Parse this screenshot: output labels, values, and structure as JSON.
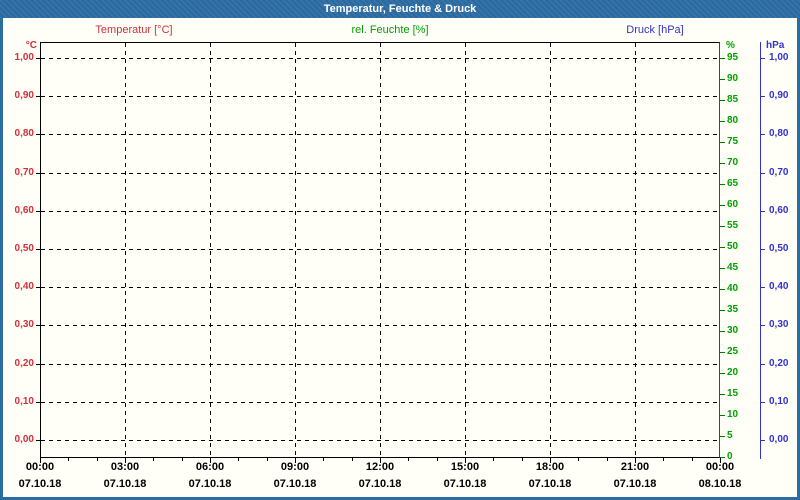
{
  "header": {
    "title": "Temperatur, Feuchte & Druck"
  },
  "colors": {
    "frame": "#2B6CA3",
    "background": "#FFFFF8",
    "temperature": "#D0303C",
    "humidity": "#00A000",
    "humidity_axis": "#007800",
    "pressure": "#3232C8",
    "grid": "#000000"
  },
  "chart_data": {
    "type": "line",
    "title": "Temperatur, Feuchte & Druck",
    "series": [
      {
        "name": "Temperatur [°C]",
        "unit": "°C",
        "color": "#D0303C",
        "values": []
      },
      {
        "name": "rel. Feuchte [%]",
        "unit": "%",
        "color": "#00A000",
        "values": []
      },
      {
        "name": "Druck [hPa]",
        "unit": "hPa",
        "color": "#3232C8",
        "values": []
      }
    ],
    "axes": {
      "temperature": {
        "unit": "°C",
        "side": "left",
        "ticks": [
          "1,00",
          "0,90",
          "0,80",
          "0,70",
          "0,60",
          "0,50",
          "0,40",
          "0,30",
          "0,20",
          "0,10",
          "0,00"
        ]
      },
      "humidity": {
        "unit": "%",
        "side": "right-inner",
        "ticks": [
          "95",
          "90",
          "85",
          "80",
          "75",
          "70",
          "65",
          "60",
          "55",
          "50",
          "45",
          "40",
          "35",
          "30",
          "25",
          "20",
          "15",
          "10",
          "5",
          "0"
        ]
      },
      "pressure": {
        "unit": "hPa",
        "side": "right-outer",
        "ticks": [
          "1,00",
          "0,90",
          "0,80",
          "0,70",
          "0,60",
          "0,50",
          "0,40",
          "0,30",
          "0,20",
          "0,10",
          "0,00"
        ]
      },
      "x": {
        "ticks": [
          {
            "time": "00:00",
            "date": "07.10.18"
          },
          {
            "time": "03:00",
            "date": "07.10.18"
          },
          {
            "time": "06:00",
            "date": "07.10.18"
          },
          {
            "time": "09:00",
            "date": "07.10.18"
          },
          {
            "time": "12:00",
            "date": "07.10.18"
          },
          {
            "time": "15:00",
            "date": "07.10.18"
          },
          {
            "time": "18:00",
            "date": "07.10.18"
          },
          {
            "time": "21:00",
            "date": "07.10.18"
          },
          {
            "time": "00:00",
            "date": "08.10.18"
          }
        ],
        "hours_total": 24,
        "minor_tick_every_hours": 1
      }
    },
    "grid": {
      "horizontal": "dashed",
      "vertical": "dashed"
    }
  }
}
